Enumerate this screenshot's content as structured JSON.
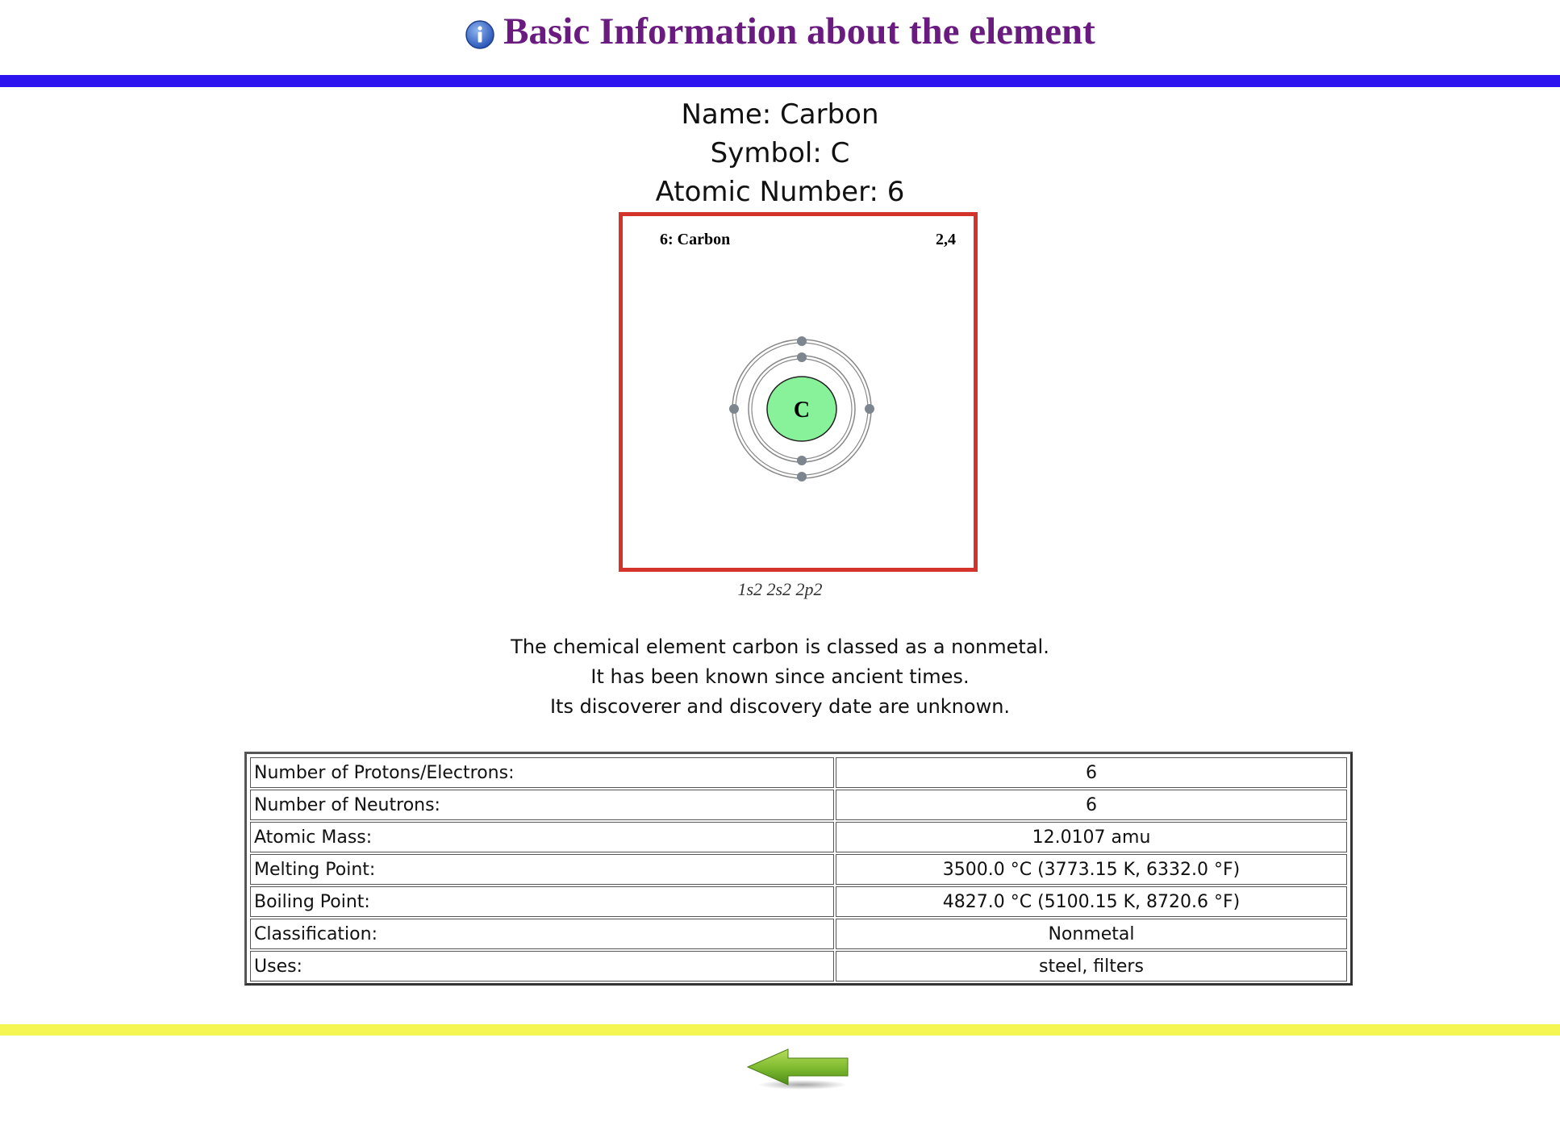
{
  "header": {
    "title": "Basic Information about the element"
  },
  "element": {
    "name_line": "Name: Carbon",
    "symbol_line": "Symbol: C",
    "number_line": "Atomic Number: 6"
  },
  "diagram": {
    "label": "6: Carbon",
    "shells_label": "2,4",
    "symbol": "C",
    "shells": [
      2,
      4
    ],
    "nucleus_color": "#88f29a",
    "border_color": "#d3332a"
  },
  "electron_config": "1s2 2s2 2p2",
  "description": [
    "The chemical element carbon is classed as a nonmetal.",
    "It has been known since ancient times.",
    "Its discoverer and discovery date are unknown."
  ],
  "properties": [
    {
      "label": "Number of Protons/Electrons:",
      "value": "6"
    },
    {
      "label": "Number of Neutrons:",
      "value": "6"
    },
    {
      "label": "Atomic Mass:",
      "value": "12.0107 amu"
    },
    {
      "label": "Melting Point:",
      "value": "3500.0 °C (3773.15 K, 6332.0 °F)"
    },
    {
      "label": "Boiling Point:",
      "value": "4827.0 °C (5100.15 K, 8720.6 °F)"
    },
    {
      "label": "Classification:",
      "value": "Nonmetal"
    },
    {
      "label": "Uses:",
      "value": "steel, filters"
    }
  ],
  "colors": {
    "title": "#6a1b7f",
    "top_bar": "#2b14ee",
    "bottom_bar": "#f6f653"
  },
  "icons": {
    "header": "info-icon",
    "footer": "back-arrow-icon"
  }
}
